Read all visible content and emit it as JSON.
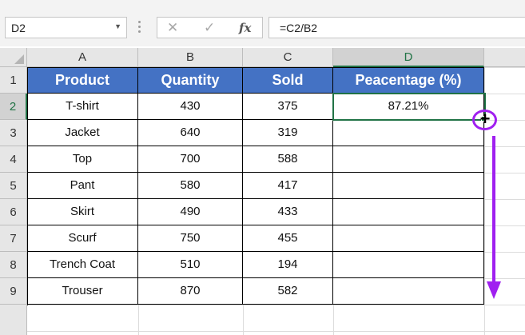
{
  "formula_bar": {
    "name_box": "D2",
    "formula": "=C2/B2",
    "cancel_glyph": "✕",
    "enter_glyph": "✓",
    "function_glyph": "fx",
    "name_box_arrow": "▼"
  },
  "columns": [
    "A",
    "B",
    "C",
    "D"
  ],
  "rows": [
    "1",
    "2",
    "3",
    "4",
    "5",
    "6",
    "7",
    "8",
    "9"
  ],
  "table": {
    "headers": [
      "Product",
      "Quantity",
      "Sold",
      "Peacentage (%)"
    ],
    "data": [
      [
        "T-shirt",
        "430",
        "375",
        "87.21%"
      ],
      [
        "Jacket",
        "640",
        "319",
        ""
      ],
      [
        "Top",
        "700",
        "588",
        ""
      ],
      [
        "Pant",
        "580",
        "417",
        ""
      ],
      [
        "Skirt",
        "490",
        "433",
        ""
      ],
      [
        "Scurf",
        "750",
        "455",
        ""
      ],
      [
        "Trench Coat",
        "510",
        "194",
        ""
      ],
      [
        "Trouser",
        "870",
        "582",
        ""
      ]
    ]
  },
  "selected_cell": "D2",
  "cursor_glyph": "+",
  "colors": {
    "header_fill": "#4472c4",
    "selection": "#217346",
    "annotation": "#a020f0"
  }
}
